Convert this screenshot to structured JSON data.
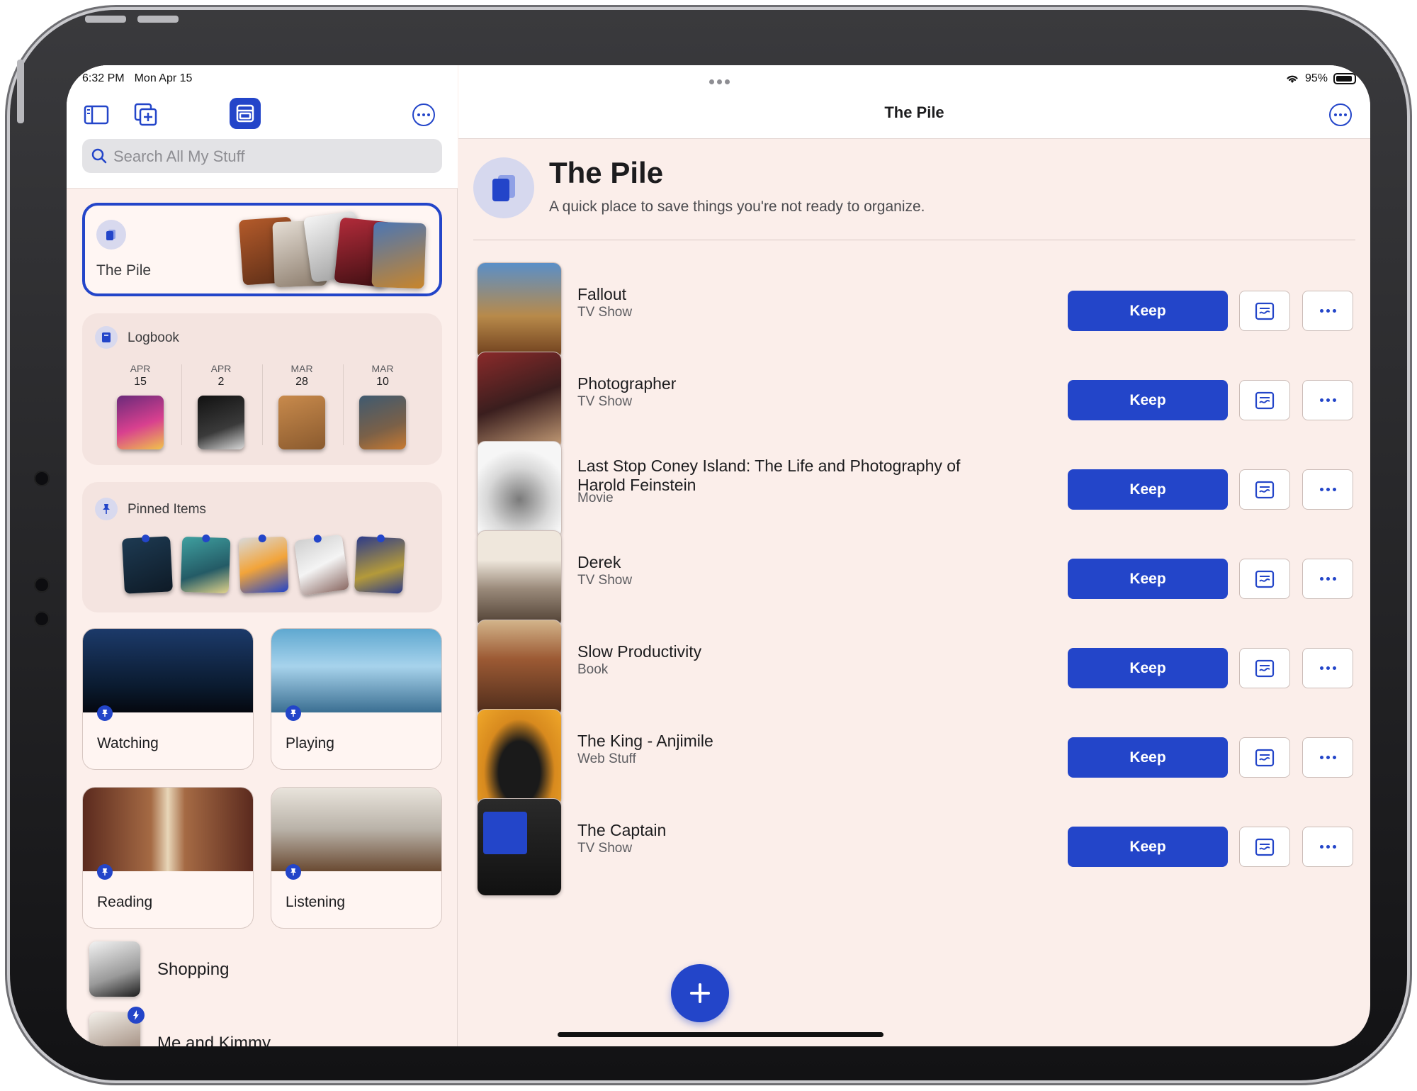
{
  "status": {
    "time": "6:32 PM",
    "date": "Mon Apr 15",
    "battery": "95%"
  },
  "sidebar": {
    "search_placeholder": "Search All My Stuff",
    "pile_label": "The Pile",
    "logbook": {
      "title": "Logbook",
      "entries": [
        {
          "month": "APR",
          "day": "15"
        },
        {
          "month": "APR",
          "day": "2"
        },
        {
          "month": "MAR",
          "day": "28"
        },
        {
          "month": "MAR",
          "day": "10"
        }
      ]
    },
    "pinned_title": "Pinned Items",
    "tiles": [
      "Watching",
      "Playing",
      "Reading",
      "Listening"
    ],
    "lists": [
      "Shopping",
      "Me and Kimmy"
    ]
  },
  "main": {
    "header_title": "The Pile",
    "hero_title": "The Pile",
    "hero_subtitle": "A quick place to save things you're not ready to organize.",
    "keep_label": "Keep",
    "items": [
      {
        "title": "Fallout",
        "type": "TV Show"
      },
      {
        "title": "Photographer",
        "type": "TV Show"
      },
      {
        "title": "Last Stop Coney Island: The Life and Photography of Harold Feinstein",
        "type": "Movie"
      },
      {
        "title": "Derek",
        "type": "TV Show"
      },
      {
        "title": "Slow Productivity",
        "type": "Book"
      },
      {
        "title": "The King - Anjimile",
        "type": "Web Stuff"
      },
      {
        "title": "The Captain",
        "type": "TV Show"
      }
    ]
  },
  "colors": {
    "accent": "#2345c9",
    "background": "#fbeeea"
  }
}
